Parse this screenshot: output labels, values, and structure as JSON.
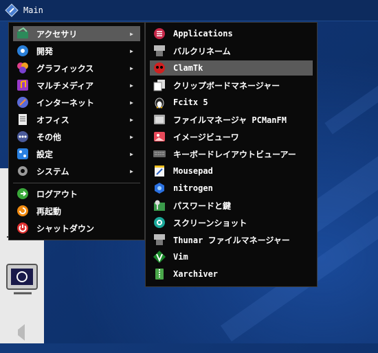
{
  "taskbar": {
    "label": "Main"
  },
  "main_menu": {
    "items": [
      {
        "label": "アクセサリ",
        "icon": "accessories-icon",
        "submenu": true,
        "highlighted": true
      },
      {
        "label": "開発",
        "icon": "development-icon",
        "submenu": true
      },
      {
        "label": "グラフィックス",
        "icon": "graphics-icon",
        "submenu": true
      },
      {
        "label": "マルチメディア",
        "icon": "multimedia-icon",
        "submenu": true
      },
      {
        "label": "インターネット",
        "icon": "internet-icon",
        "submenu": true
      },
      {
        "label": "オフィス",
        "icon": "office-icon",
        "submenu": true
      },
      {
        "label": "その他",
        "icon": "other-icon",
        "submenu": true
      },
      {
        "label": "設定",
        "icon": "settings-icon",
        "submenu": true
      },
      {
        "label": "システム",
        "icon": "system-icon",
        "submenu": true
      }
    ],
    "session": [
      {
        "label": "ログアウト",
        "icon": "logout-icon"
      },
      {
        "label": "再起動",
        "icon": "reboot-icon"
      },
      {
        "label": "シャットダウン",
        "icon": "shutdown-icon"
      }
    ],
    "arrow_glyph": "▶"
  },
  "submenu": {
    "items": [
      {
        "label": "Applications",
        "icon": "applications-icon"
      },
      {
        "label": "バルクリネーム",
        "icon": "bulk-rename-icon"
      },
      {
        "label": "ClamTk",
        "icon": "clamtk-icon",
        "highlighted": true
      },
      {
        "label": "クリップボードマネージャー",
        "icon": "clipboard-icon"
      },
      {
        "label": "Fcitx 5",
        "icon": "fcitx-penguin-icon"
      },
      {
        "label": "ファイルマネージャ PCManFM",
        "icon": "file-manager-icon"
      },
      {
        "label": "イメージビューワ",
        "icon": "image-viewer-icon"
      },
      {
        "label": "キーボードレイアウトビューアー",
        "icon": "keyboard-icon"
      },
      {
        "label": "Mousepad",
        "icon": "mousepad-icon"
      },
      {
        "label": "nitrogen",
        "icon": "nitrogen-icon"
      },
      {
        "label": "パスワードと鍵",
        "icon": "password-keys-icon"
      },
      {
        "label": "スクリーンショット",
        "icon": "screenshot-icon"
      },
      {
        "label": "Thunar ファイルマネージャー",
        "icon": "thunar-icon"
      },
      {
        "label": "Vim",
        "icon": "vim-icon"
      },
      {
        "label": "Xarchiver",
        "icon": "xarchiver-icon"
      }
    ]
  },
  "colors": {
    "menu_bg": "#0a0a0a",
    "highlight": "#5a5a5a",
    "desktop": "#0f3370"
  }
}
